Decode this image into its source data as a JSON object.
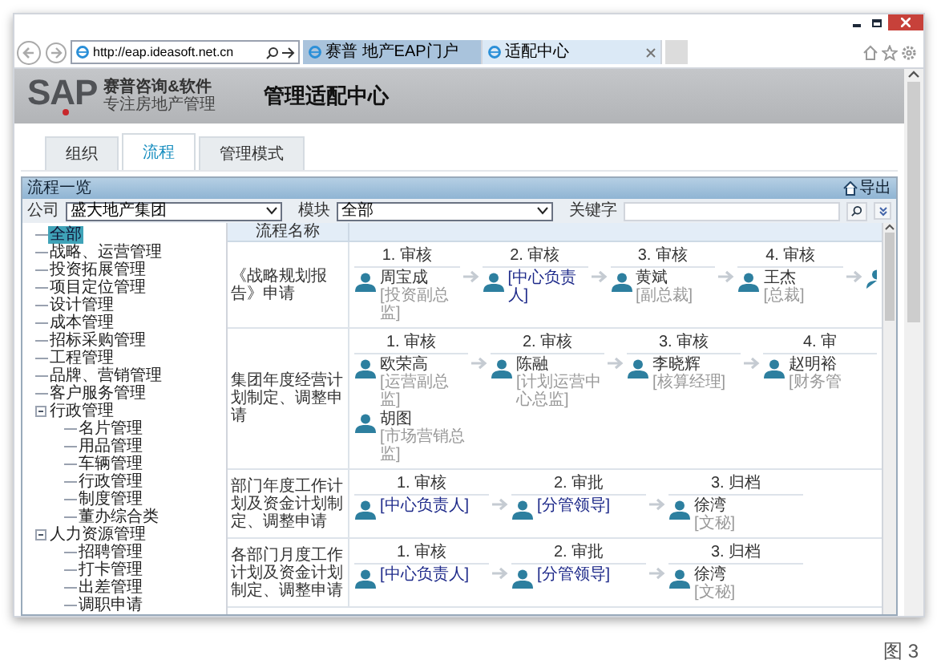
{
  "browser": {
    "address": "http://eap.ideasoft.net.cn",
    "tabs": [
      {
        "title": "赛普 地产EAP门户",
        "selected": false
      },
      {
        "title": "适配中心",
        "selected": true
      }
    ]
  },
  "header": {
    "logo": "SAP",
    "company": "赛普咨询&软件",
    "slogan": "专注房地产管理",
    "title": "管理适配中心"
  },
  "nav_tabs": [
    {
      "label": "组织",
      "selected": false
    },
    {
      "label": "流程",
      "selected": true
    },
    {
      "label": "管理模式",
      "selected": false
    }
  ],
  "panel": {
    "title": "流程一览",
    "export": "导出"
  },
  "filters": {
    "company_label": "公司",
    "company": "盛大地产集团",
    "module_label": "模块",
    "module": "全部",
    "keyword_label": "关键字"
  },
  "tree": [
    {
      "label": "全部",
      "selected": true
    },
    {
      "label": "战略、运营管理",
      "selected": false
    },
    {
      "label": "投资拓展管理",
      "selected": false
    },
    {
      "label": "项目定位管理",
      "selected": false
    },
    {
      "label": "设计管理",
      "selected": false
    },
    {
      "label": "成本管理",
      "selected": false
    },
    {
      "label": "招标采购管理",
      "selected": false
    },
    {
      "label": "工程管理",
      "selected": false
    },
    {
      "label": "品牌、营销管理",
      "selected": false
    },
    {
      "label": "客户服务管理",
      "selected": false
    },
    {
      "label": "行政管理",
      "selected": false,
      "expanded": true,
      "children": [
        {
          "label": "名片管理",
          "selected": false
        },
        {
          "label": "用品管理",
          "selected": false
        },
        {
          "label": "车辆管理",
          "selected": false
        },
        {
          "label": "行政管理",
          "selected": false
        },
        {
          "label": "制度管理",
          "selected": false
        },
        {
          "label": "董办综合类",
          "selected": false
        }
      ]
    },
    {
      "label": "人力资源管理",
      "selected": false,
      "expanded": true,
      "children": [
        {
          "label": "招聘管理",
          "selected": false
        },
        {
          "label": "打卡管理",
          "selected": false
        },
        {
          "label": "出差管理",
          "selected": false
        },
        {
          "label": "调职申请",
          "selected": false
        }
      ]
    }
  ],
  "table": {
    "columns": [
      "流程名称"
    ],
    "rows": [
      {
        "name": "《战略规划报告》申请",
        "more": true,
        "steps": [
          {
            "label": "1. 审核",
            "persons": [
              {
                "name": "周宝成",
                "role": "[投资副总监]"
              }
            ]
          },
          {
            "label": "2. 审核",
            "persons": [
              {
                "role": "[中心负责人]"
              }
            ]
          },
          {
            "label": "3. 审核",
            "persons": [
              {
                "name": "黄斌",
                "role": "[副总裁]"
              }
            ]
          },
          {
            "label": "4. 审核",
            "persons": [
              {
                "name": "王杰",
                "role": "[总裁]"
              }
            ]
          }
        ]
      },
      {
        "name": "集团年度经营计划制定、调整申请",
        "more": false,
        "steps": [
          {
            "label": "1. 审核",
            "persons": [
              {
                "name": "欧荣高",
                "role": "[运营副总监]"
              },
              {
                "name": "胡图",
                "role": "[市场营销总监]"
              }
            ]
          },
          {
            "label": "2. 审核",
            "persons": [
              {
                "name": "陈融",
                "role": "[计划运营中心总监]"
              }
            ]
          },
          {
            "label": "3. 审核",
            "persons": [
              {
                "name": "李晓辉",
                "role": "[核算经理]"
              }
            ]
          },
          {
            "label": "4. 审",
            "persons": [
              {
                "name": "赵明裕",
                "role": "[财务管"
              }
            ]
          }
        ]
      },
      {
        "name": "部门年度工作计划及资金计划制定、调整申请",
        "more": false,
        "steps": [
          {
            "label": "1. 审核",
            "persons": [
              {
                "role": "[中心负责人]"
              }
            ]
          },
          {
            "label": "2. 审批",
            "persons": [
              {
                "role": "[分管领导]"
              }
            ]
          },
          {
            "label": "3. 归档",
            "persons": [
              {
                "name": "徐湾",
                "role": "[文秘]"
              }
            ]
          }
        ]
      },
      {
        "name": "各部门月度工作计划及资金计划制定、调整申请",
        "more": false,
        "steps": [
          {
            "label": "1. 审核",
            "persons": [
              {
                "role": "[中心负责人]"
              }
            ]
          },
          {
            "label": "2. 审批",
            "persons": [
              {
                "role": "[分管领导]"
              }
            ]
          },
          {
            "label": "3. 归档",
            "persons": [
              {
                "name": "徐湾",
                "role": "[文秘]"
              }
            ]
          }
        ]
      }
    ]
  },
  "caption": "图 3"
}
